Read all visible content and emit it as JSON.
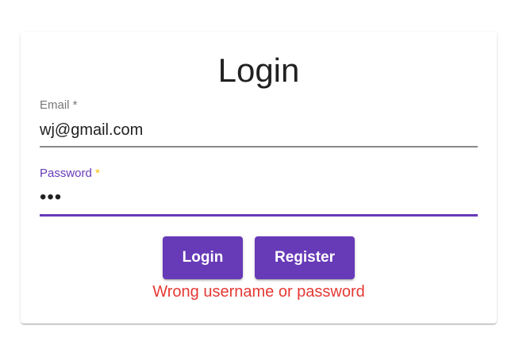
{
  "login_form": {
    "title": "Login",
    "email": {
      "label": "Email",
      "required_marker": " *",
      "value": "wj@gmail.com"
    },
    "password": {
      "label": "Password",
      "required_marker": " *",
      "masked_value": "•••"
    },
    "buttons": {
      "login_label": "Login",
      "register_label": "Register"
    },
    "error_message": "Wrong username or password"
  },
  "colors": {
    "primary": "#673ab7",
    "required_focused": "#ffc107",
    "error": "#e53935",
    "text": "#212121",
    "label_muted": "#8a8a8a"
  }
}
